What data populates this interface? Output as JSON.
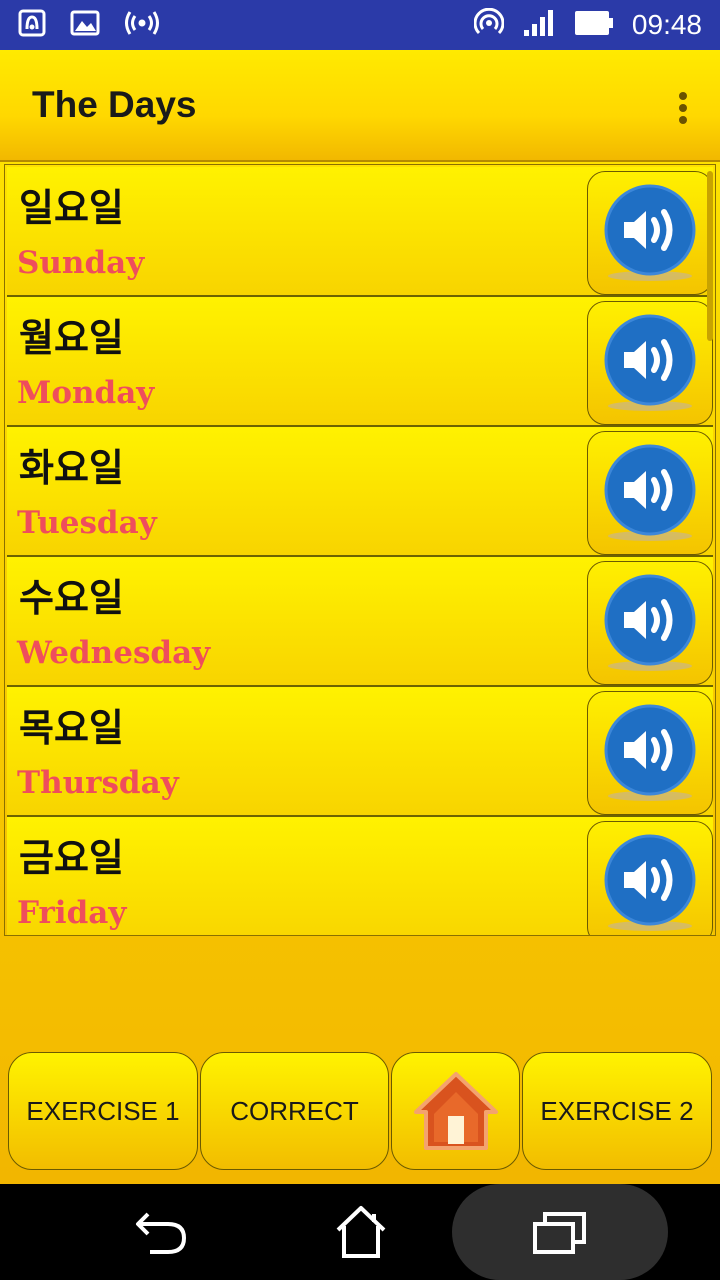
{
  "status_bar": {
    "time": "09:48",
    "icons": [
      "nfc-icon",
      "image-icon",
      "broadcast-icon",
      "hotspot-icon",
      "signal-icon",
      "battery-icon"
    ]
  },
  "app_bar": {
    "title": "The Days",
    "menu_icon": "overflow-menu-icon"
  },
  "days": [
    {
      "korean": "일요일",
      "english": "Sunday"
    },
    {
      "korean": "월요일",
      "english": "Monday"
    },
    {
      "korean": "화요일",
      "english": "Tuesday"
    },
    {
      "korean": "수요일",
      "english": "Wednesday"
    },
    {
      "korean": "목요일",
      "english": "Thursday"
    },
    {
      "korean": "금요일",
      "english": "Friday"
    }
  ],
  "buttons": {
    "exercise1": "EXERCISE 1",
    "correct": "CORRECT",
    "home_icon": "home-icon",
    "exercise2": "EXERCISE 2"
  },
  "nav_bar": {
    "icons": [
      "back-icon",
      "home-icon",
      "recents-icon"
    ]
  },
  "colors": {
    "status_bar": "#2b3aa8",
    "accent_yellow": "#ffe600",
    "english_text": "#ef4d5c",
    "speaker_blue": "#1f6fc4"
  }
}
